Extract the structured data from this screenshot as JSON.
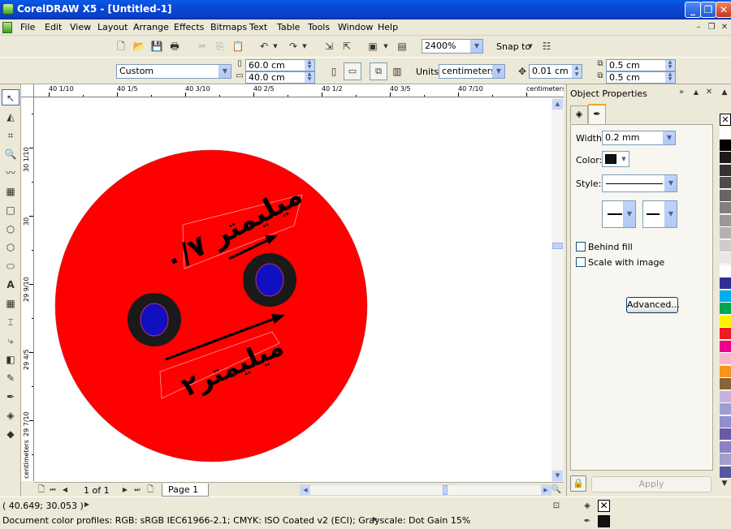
{
  "window": {
    "title": "CorelDRAW X5 - [Untitled-1]",
    "min_label": "_",
    "max_label": "❐",
    "close_label": "✕"
  },
  "menubar": {
    "items": [
      "File",
      "Edit",
      "View",
      "Layout",
      "Arrange",
      "Effects",
      "Bitmaps",
      "Text",
      "Table",
      "Tools",
      "Window",
      "Help"
    ]
  },
  "toolbar": {
    "zoom_value": "2400%",
    "snap_to_label": "Snap to"
  },
  "property_bar": {
    "page_size": "Custom",
    "width_value": "60.0 cm",
    "height_value": "40.0 cm",
    "units_label": "Units:",
    "units_value": "centimeters",
    "nudge_value": "0.01 cm",
    "dup_x_value": "0.5 cm",
    "dup_y_value": "0.5 cm"
  },
  "ruler": {
    "h_labels": [
      "40 1/10",
      "40 1/5",
      "40 3/10",
      "40 2/5",
      "40 1/2",
      "40 3/5",
      "40 7/10",
      "centimeters"
    ],
    "v_labels": [
      "30 1/10",
      "30",
      "29 9/10",
      "29 4/5",
      "29 7/10",
      "centimeters"
    ]
  },
  "drawing": {
    "circle_color": "#ff0000",
    "eye_ring_color": "#1a1a1a",
    "eye_color": "#1010c0",
    "text_top": "۰/۷ میلیمتر",
    "text_bottom": "۲میلیمتر"
  },
  "page_nav": {
    "page_count": "1 of 1",
    "page_tab": "Page 1"
  },
  "docker": {
    "title": "Object Properties",
    "width_label": "Width",
    "width_value": "0.2 mm",
    "color_label": "Color:",
    "color_value": "#111111",
    "style_label": "Style:",
    "behind_fill_label": "Behind fill",
    "scale_with_image_label": "Scale with image",
    "advanced_button": "Advanced...",
    "apply_button": "Apply"
  },
  "palette": {
    "colors": [
      "#ffffff",
      "#000000",
      "#1a1a1a",
      "#333333",
      "#4d4d4d",
      "#666666",
      "#808080",
      "#999999",
      "#b3b3b3",
      "#cccccc",
      "#e6e6e6",
      "#ffffff",
      "#2e3192",
      "#00aeef",
      "#00a651",
      "#fff200",
      "#ed1c24",
      "#ec008c",
      "#f7b7c8",
      "#f7941d",
      "#8c6239",
      "#c7b2de",
      "#9e9cd2",
      "#8f8fcf",
      "#6a5aa5",
      "#8a82c4",
      "#a39ecc",
      "#5559a5"
    ]
  },
  "status": {
    "coords": "( 40.649; 30.053 )",
    "color_profiles": "Document color profiles: RGB: sRGB IEC61966-2.1; CMYK: ISO Coated v2 (ECI); Grayscale: Dot Gain 15%"
  }
}
